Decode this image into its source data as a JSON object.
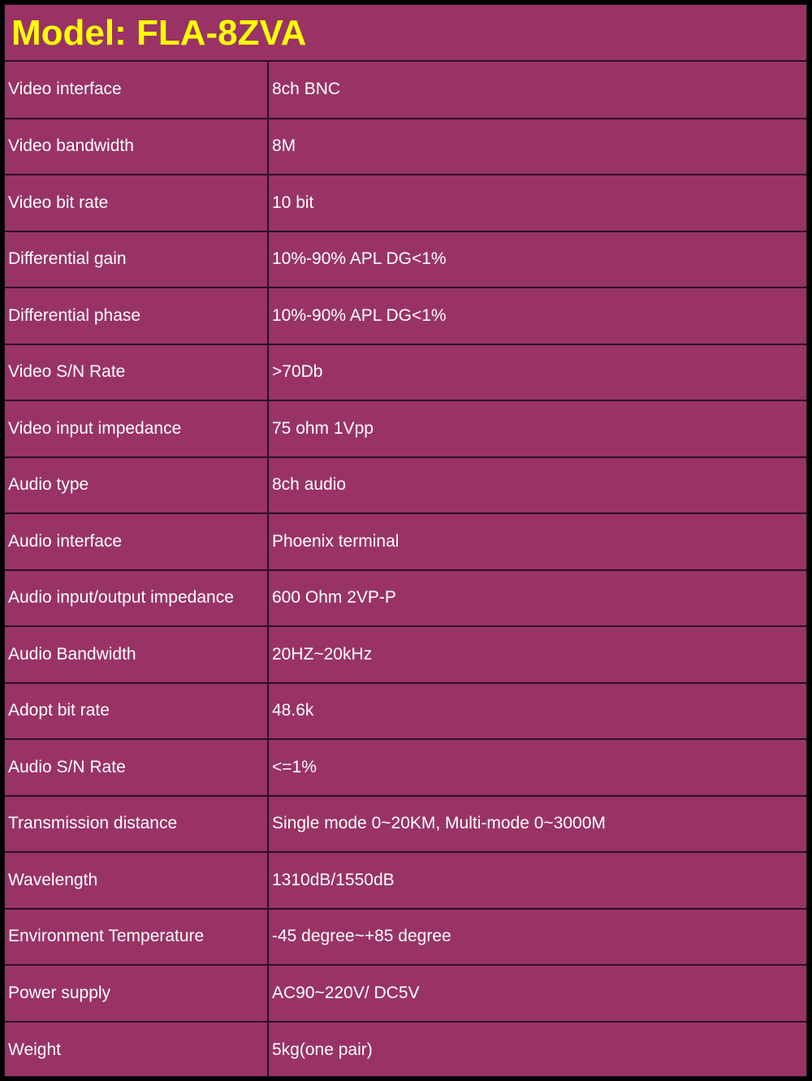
{
  "title": "Model: FLA-8ZVA",
  "colors": {
    "background": "#993366",
    "title_text": "#FFFF00",
    "cell_text": "#FFFFFF",
    "frame": "#000000"
  },
  "rows": [
    {
      "label": "Video interface",
      "value": "8ch BNC"
    },
    {
      "label": "Video bandwidth",
      "value": "8M"
    },
    {
      "label": "Video bit rate",
      "value": "10 bit"
    },
    {
      "label": "Differential gain",
      "value": "10%-90% APL DG<1%"
    },
    {
      "label": "Differential phase",
      "value": "10%-90% APL DG<1%"
    },
    {
      "label": "Video S/N Rate",
      "value": ">70Db"
    },
    {
      "label": "Video input impedance",
      "value": "75 ohm 1Vpp"
    },
    {
      "label": "Audio type",
      "value": "8ch  audio"
    },
    {
      "label": "Audio interface",
      "value": "Phoenix terminal"
    },
    {
      "label": "Audio input/output  impedance",
      "value": "600 Ohm 2VP-P"
    },
    {
      "label": "Audio Bandwidth",
      "value": "20HZ~20kHz"
    },
    {
      "label": "Adopt bit rate",
      "value": "48.6k"
    },
    {
      "label": "Audio S/N Rate",
      "value": "<=1%"
    },
    {
      "label": "Transmission distance",
      "value": "Single mode 0~20KM, Multi-mode 0~3000M"
    },
    {
      "label": "Wavelength",
      "value": "1310dB/1550dB"
    },
    {
      "label": "Environment Temperature",
      "value": "-45 degree~+85 degree"
    },
    {
      "label": "Power supply",
      "value": "AC90~220V/ DC5V"
    },
    {
      "label": "Weight",
      "value": "5kg(one pair)"
    }
  ]
}
